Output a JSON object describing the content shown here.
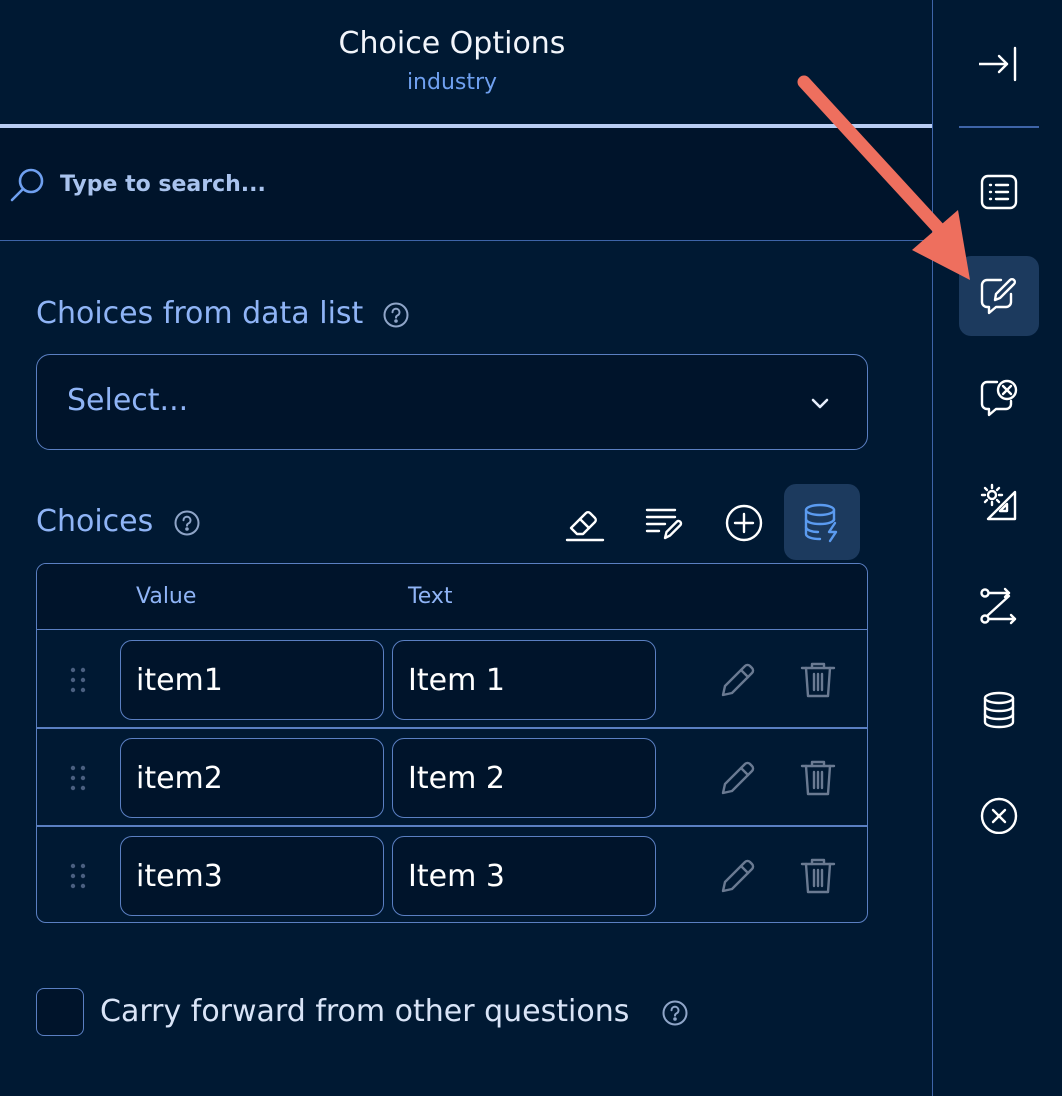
{
  "panel": {
    "title": "Choice Options",
    "subtitle": "industry"
  },
  "search": {
    "placeholder": "Type to search..."
  },
  "choices_from_data_list": {
    "label": "Choices from data list",
    "select_placeholder": "Select..."
  },
  "choices": {
    "label": "Choices",
    "columns": [
      "Value",
      "Text"
    ],
    "rows": [
      {
        "value": "item1",
        "text": "Item 1"
      },
      {
        "value": "item2",
        "text": "Item 2"
      },
      {
        "value": "item3",
        "text": "Item 3"
      }
    ],
    "toolbar_icons": [
      "eraser-icon",
      "edit-list-icon",
      "plus-circle-icon",
      "database-lightning-icon"
    ]
  },
  "carry_forward": {
    "label": "Carry forward from other questions",
    "checked": false
  },
  "rail": {
    "icons": [
      "collapse-panel-icon",
      "list-icon",
      "edit-message-icon",
      "message-cancel-icon",
      "settings-ruler-icon",
      "logic-flow-icon",
      "database-icon",
      "close-circle-icon"
    ],
    "active": "edit-message-icon"
  },
  "colors": {
    "background": "#001933",
    "input_background": "#00142b",
    "border": "#5a7fc2",
    "label": "#8fb4f6",
    "active_button": "#1c3a5e",
    "annotation_arrow": "#ee6f5e"
  }
}
